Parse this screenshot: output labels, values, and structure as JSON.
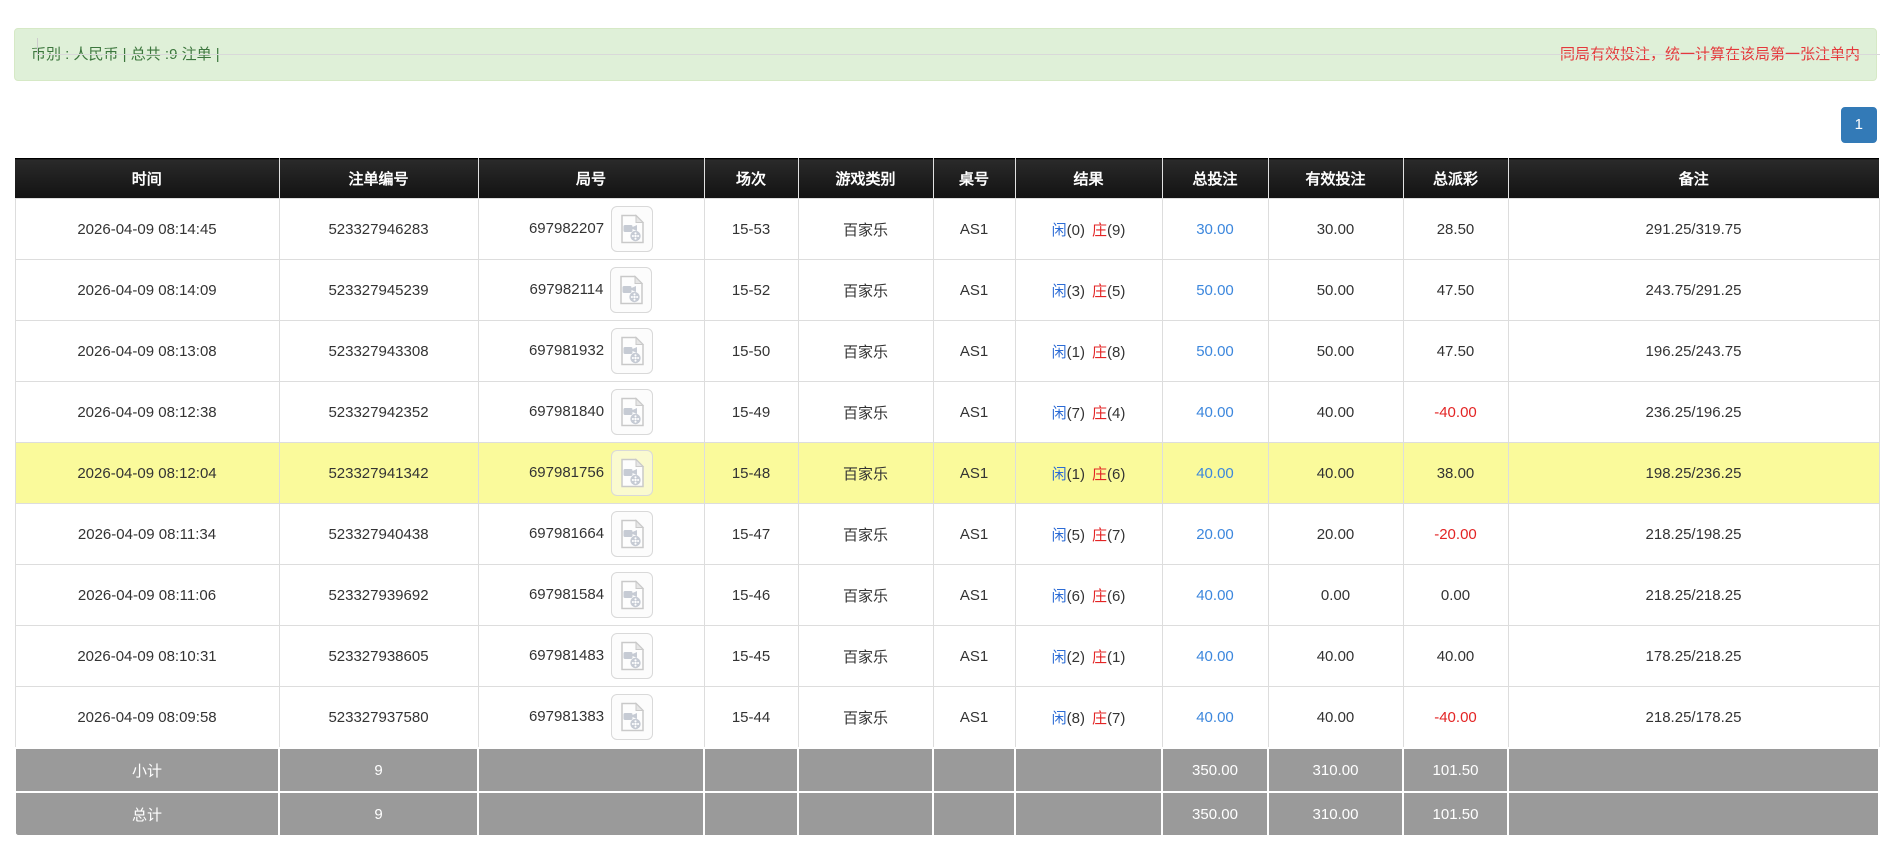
{
  "banner": {
    "left_text": "币别 : 人民币 | 总共 :9 注单 |",
    "right_note": "同局有效投注，统一计算在该局第一张注单内"
  },
  "pagination": {
    "current_page": "1"
  },
  "table": {
    "columns": [
      "时间",
      "注单编号",
      "局号",
      "场次",
      "游戏类别",
      "桌号",
      "结果",
      "总投注",
      "有效投注",
      "总派彩",
      "备注"
    ],
    "result_labels": {
      "player": "闲",
      "banker": "庄"
    },
    "rows": [
      {
        "time": "2026-04-09 08:14:45",
        "bet_id": "523327946283",
        "round_no": "697982207",
        "session": "15-53",
        "game_type": "百家乐",
        "table_no": "AS1",
        "player_points": "(0)",
        "banker_points": "(9)",
        "total_bet": "30.00",
        "valid_bet": "30.00",
        "payout": "28.50",
        "remark": "291.25/319.75",
        "highlight": false
      },
      {
        "time": "2026-04-09 08:14:09",
        "bet_id": "523327945239",
        "round_no": "697982114",
        "session": "15-52",
        "game_type": "百家乐",
        "table_no": "AS1",
        "player_points": "(3)",
        "banker_points": "(5)",
        "total_bet": "50.00",
        "valid_bet": "50.00",
        "payout": "47.50",
        "remark": "243.75/291.25",
        "highlight": false
      },
      {
        "time": "2026-04-09 08:13:08",
        "bet_id": "523327943308",
        "round_no": "697981932",
        "session": "15-50",
        "game_type": "百家乐",
        "table_no": "AS1",
        "player_points": "(1)",
        "banker_points": "(8)",
        "total_bet": "50.00",
        "valid_bet": "50.00",
        "payout": "47.50",
        "remark": "196.25/243.75",
        "highlight": false
      },
      {
        "time": "2026-04-09 08:12:38",
        "bet_id": "523327942352",
        "round_no": "697981840",
        "session": "15-49",
        "game_type": "百家乐",
        "table_no": "AS1",
        "player_points": "(7)",
        "banker_points": "(4)",
        "total_bet": "40.00",
        "valid_bet": "40.00",
        "payout": "-40.00",
        "remark": "236.25/196.25",
        "highlight": false
      },
      {
        "time": "2026-04-09 08:12:04",
        "bet_id": "523327941342",
        "round_no": "697981756",
        "session": "15-48",
        "game_type": "百家乐",
        "table_no": "AS1",
        "player_points": "(1)",
        "banker_points": "(6)",
        "total_bet": "40.00",
        "valid_bet": "40.00",
        "payout": "38.00",
        "remark": "198.25/236.25",
        "highlight": true
      },
      {
        "time": "2026-04-09 08:11:34",
        "bet_id": "523327940438",
        "round_no": "697981664",
        "session": "15-47",
        "game_type": "百家乐",
        "table_no": "AS1",
        "player_points": "(5)",
        "banker_points": "(7)",
        "total_bet": "20.00",
        "valid_bet": "20.00",
        "payout": "-20.00",
        "remark": "218.25/198.25",
        "highlight": false
      },
      {
        "time": "2026-04-09 08:11:06",
        "bet_id": "523327939692",
        "round_no": "697981584",
        "session": "15-46",
        "game_type": "百家乐",
        "table_no": "AS1",
        "player_points": "(6)",
        "banker_points": "(6)",
        "total_bet": "40.00",
        "valid_bet": "0.00",
        "payout": "0.00",
        "remark": "218.25/218.25",
        "highlight": false
      },
      {
        "time": "2026-04-09 08:10:31",
        "bet_id": "523327938605",
        "round_no": "697981483",
        "session": "15-45",
        "game_type": "百家乐",
        "table_no": "AS1",
        "player_points": "(2)",
        "banker_points": "(1)",
        "total_bet": "40.00",
        "valid_bet": "40.00",
        "payout": "40.00",
        "remark": "178.25/218.25",
        "highlight": false
      },
      {
        "time": "2026-04-09 08:09:58",
        "bet_id": "523327937580",
        "round_no": "697981383",
        "session": "15-44",
        "game_type": "百家乐",
        "table_no": "AS1",
        "player_points": "(8)",
        "banker_points": "(7)",
        "total_bet": "40.00",
        "valid_bet": "40.00",
        "payout": "-40.00",
        "remark": "218.25/178.25",
        "highlight": false
      }
    ],
    "subtotal": {
      "label": "小计",
      "count": "9",
      "total_bet": "350.00",
      "valid_bet": "310.00",
      "payout": "101.50"
    },
    "grand_total": {
      "label": "总计",
      "count": "9",
      "total_bet": "350.00",
      "valid_bet": "310.00",
      "payout": "101.50"
    }
  },
  "colors": {
    "banner_bg": "#dff0d8",
    "banner_text": "#3c763d",
    "note_red": "#e4393c",
    "link_blue": "#3c87dd",
    "player_blue": "#2b6bd5",
    "banker_red": "#e32424",
    "negative_red": "#e32424",
    "highlight_yellow": "#fafa9b",
    "totals_gray": "#9a9a9a",
    "pagination_blue": "#337ab7",
    "header_bg": "#1c1c1c"
  }
}
